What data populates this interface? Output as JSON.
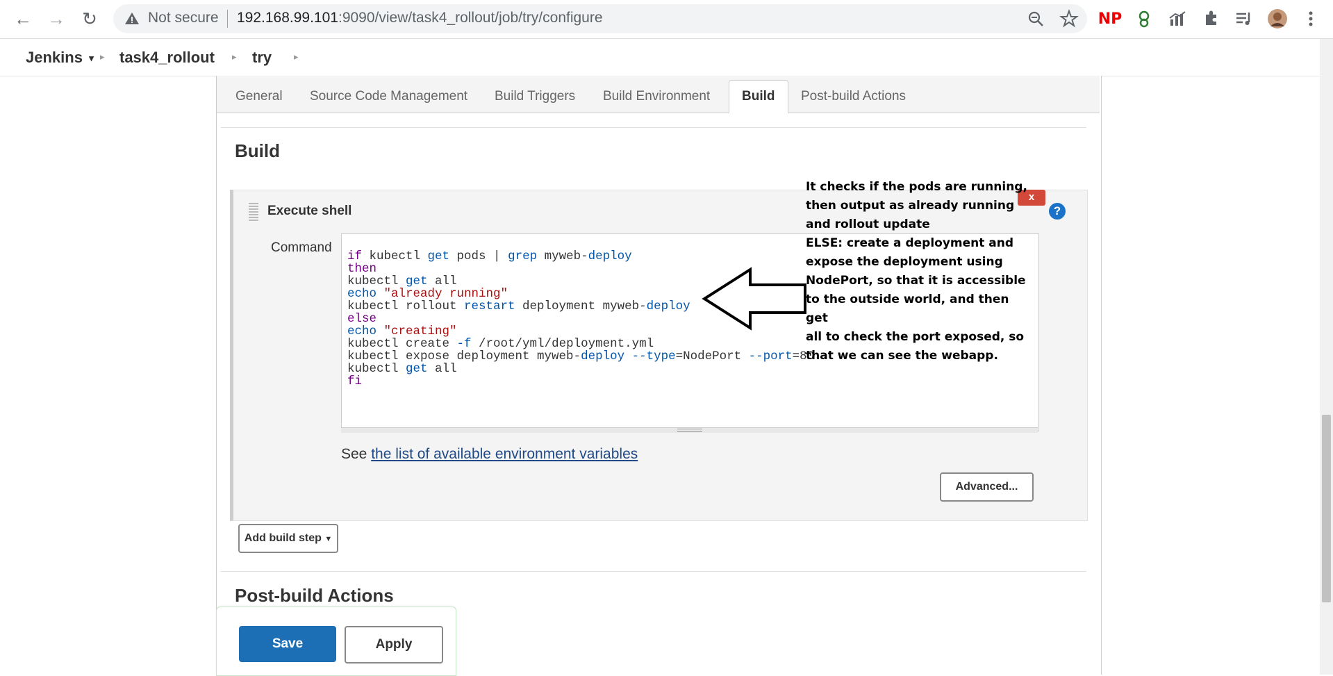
{
  "browser": {
    "security_label": "Not secure",
    "url_host": "192.168.99.101",
    "url_path": ":9090/view/task4_rollout/job/try/configure"
  },
  "breadcrumb": {
    "items": [
      "Jenkins",
      "task4_rollout",
      "try"
    ]
  },
  "tabs": [
    "General",
    "Source Code Management",
    "Build Triggers",
    "Build Environment",
    "Build",
    "Post-build Actions"
  ],
  "build_section": {
    "title": "Build",
    "step_title": "Execute shell",
    "close_label": "x",
    "help_label": "?",
    "command_label": "Command",
    "see_prefix": "See",
    "env_link": "the list of available environment variables",
    "advanced_label": "Advanced...",
    "add_step_label": "Add build step"
  },
  "post_build": {
    "title": "Post-build Actions"
  },
  "footer": {
    "save_label": "Save",
    "apply_label": "Apply"
  },
  "annotation": {
    "lines": [
      "It checks if the pods are running,",
      "then output as already running",
      "and rollout update",
      "ELSE: create a deployment and",
      "expose the deployment using",
      "NodePort, so that it is accessible",
      "to the outside world, and then get",
      "all to check the port exposed, so",
      "that we can see the webapp."
    ]
  },
  "command_lines": [
    "if kubectl get pods | grep myweb-deploy",
    "then",
    "kubectl get all",
    "echo \"already running\"",
    "kubectl rollout restart deployment myweb-deploy",
    "else",
    "echo \"creating\"",
    "kubectl create -f /root/yml/deployment.yml",
    "kubectl expose deployment myweb-deploy --type=NodePort --port=80",
    "kubectl get all",
    "fi"
  ]
}
